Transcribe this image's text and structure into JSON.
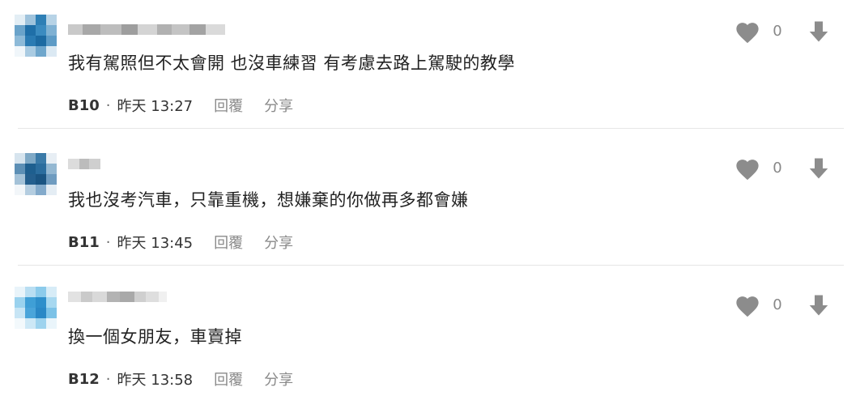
{
  "comments": [
    {
      "text": "我有駕照但不太會開 也沒車練習 有考慮去路上駕駛的教學",
      "floor": "B10",
      "time": "昨天 13:27",
      "likes": "0",
      "reply_label": "回覆",
      "share_label": "分享"
    },
    {
      "text": "我也沒考汽車，只靠重機，想嫌棄的你做再多都會嫌",
      "floor": "B11",
      "time": "昨天 13:45",
      "likes": "0",
      "reply_label": "回覆",
      "share_label": "分享"
    },
    {
      "text": "換一個女朋友，車賣掉",
      "floor": "B12",
      "time": "昨天 13:58",
      "likes": "0",
      "reply_label": "回覆",
      "share_label": "分享"
    }
  ],
  "separator": "·",
  "colors": {
    "text": "#222222",
    "muted": "#8a8a8a",
    "icon": "#8c8c8c",
    "divider": "#e6e6e6"
  },
  "icons": {
    "like": "heart-icon",
    "downvote": "arrow-down-icon"
  }
}
